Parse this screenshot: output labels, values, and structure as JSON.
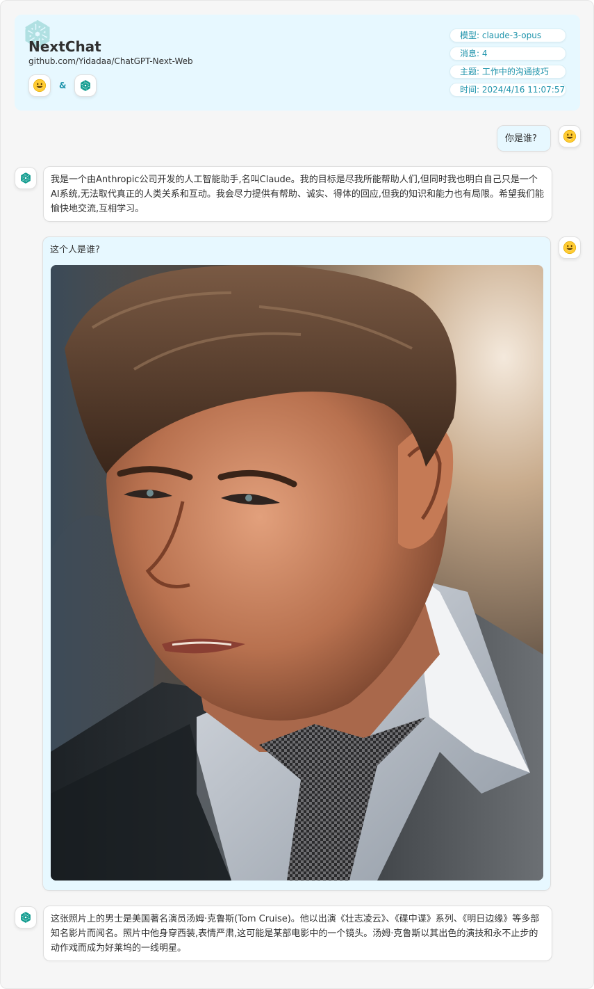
{
  "header": {
    "title": "NextChat",
    "subtitle": "github.com/Yidadaa/ChatGPT-Next-Web",
    "ampersand": "&",
    "user_avatar_icon": "grinning-face-emoji",
    "bot_avatar_icon": "openai-logo-icon",
    "meta": {
      "model": "模型: claude-3-opus",
      "messages": "消息: 4",
      "topic": "主题: 工作中的沟通技巧",
      "time": "时间: 2024/4/16 11:07:57"
    }
  },
  "messages": [
    {
      "role": "user",
      "text": "你是谁?"
    },
    {
      "role": "assistant",
      "text": "我是一个由Anthropic公司开发的人工智能助手,名叫Claude。我的目标是尽我所能帮助人们,但同时我也明白自己只是一个AI系统,无法取代真正的人类关系和互动。我会尽力提供有帮助、诚实、得体的回应,但我的知识和能力也有局限。希望我们能愉快地交流,互相学习。"
    },
    {
      "role": "user",
      "text": "这个人是谁?",
      "image": "portrait-photo-man-in-suit"
    },
    {
      "role": "assistant",
      "text": "这张照片上的男士是美国著名演员汤姆·克鲁斯(Tom Cruise)。他以出演《壮志凌云》、《碟中谍》系列、《明日边缘》等多部知名影片而闻名。照片中他身穿西装,表情严肃,这可能是某部电影中的一个镜头。汤姆·克鲁斯以其出色的演技和永不止步的动作戏而成为好莱坞的一线明星。"
    }
  ],
  "colors": {
    "accent": "#1d93ab",
    "header_bg": "#e7f8ff",
    "user_bubble_bg": "#e7f8ff",
    "bot_bubble_bg": "#ffffff",
    "page_bg": "#f6f6f6"
  }
}
